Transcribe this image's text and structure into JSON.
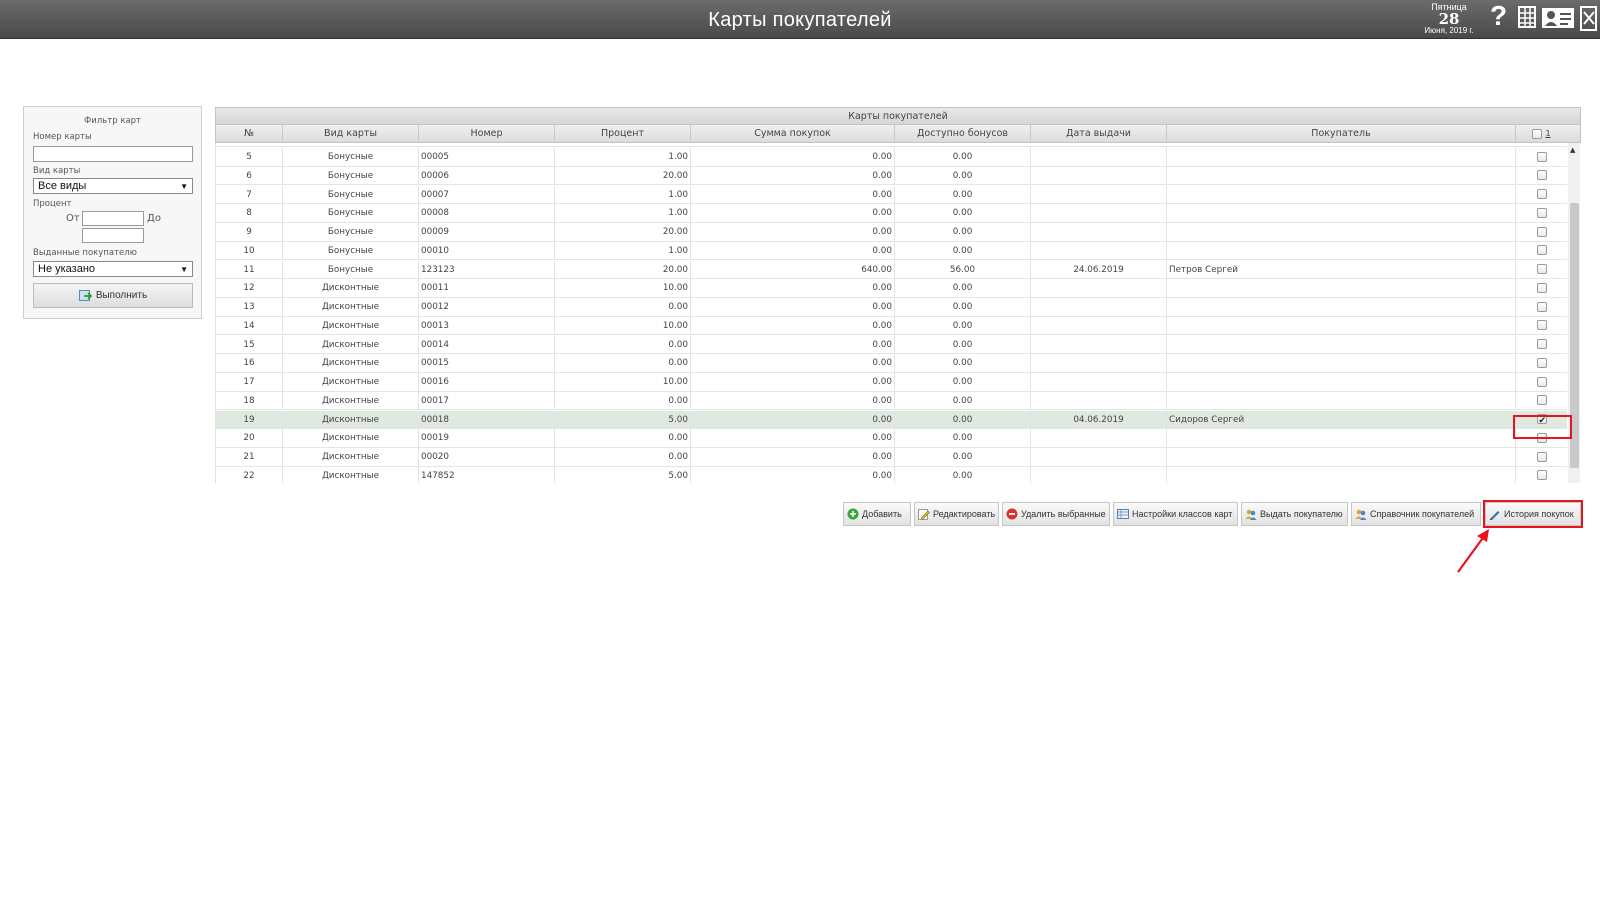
{
  "header": {
    "title": "Карты покупателей",
    "date": {
      "weekday": "Пятница",
      "day": "28",
      "month_year": "Июня, 2019 г."
    },
    "icons": [
      "help-icon",
      "grid-icon",
      "user-card-icon",
      "exit-icon"
    ]
  },
  "filter": {
    "title": "Фильтр карт",
    "card_number_label": "Номер карты",
    "card_number_value": "",
    "card_type_label": "Вид карты",
    "card_type_value": "Все виды",
    "percent_label": "Процент",
    "from_label": "От",
    "to_label": "До",
    "issued_label": "Выданные покупателю",
    "issued_value": "Не указано",
    "run_button": "Выполнить"
  },
  "grid": {
    "caption": "Карты покупателей",
    "columns": [
      "№",
      "Вид карты",
      "Номер",
      "Процент",
      "Сумма покупок",
      "Доступно бонусов",
      "Дата выдачи",
      "Покупатель"
    ],
    "select_all_count": "1",
    "rows": [
      {
        "n": "5",
        "type": "Бонусные",
        "number": "00005",
        "percent": "1.00",
        "sum": "0.00",
        "bonus": "0.00",
        "date": "",
        "buyer": "",
        "checked": false
      },
      {
        "n": "6",
        "type": "Бонусные",
        "number": "00006",
        "percent": "20.00",
        "sum": "0.00",
        "bonus": "0.00",
        "date": "",
        "buyer": "",
        "checked": false
      },
      {
        "n": "7",
        "type": "Бонусные",
        "number": "00007",
        "percent": "1.00",
        "sum": "0.00",
        "bonus": "0.00",
        "date": "",
        "buyer": "",
        "checked": false
      },
      {
        "n": "8",
        "type": "Бонусные",
        "number": "00008",
        "percent": "1.00",
        "sum": "0.00",
        "bonus": "0.00",
        "date": "",
        "buyer": "",
        "checked": false
      },
      {
        "n": "9",
        "type": "Бонусные",
        "number": "00009",
        "percent": "20.00",
        "sum": "0.00",
        "bonus": "0.00",
        "date": "",
        "buyer": "",
        "checked": false
      },
      {
        "n": "10",
        "type": "Бонусные",
        "number": "00010",
        "percent": "1.00",
        "sum": "0.00",
        "bonus": "0.00",
        "date": "",
        "buyer": "",
        "checked": false
      },
      {
        "n": "11",
        "type": "Бонусные",
        "number": "123123",
        "percent": "20.00",
        "sum": "640.00",
        "bonus": "56.00",
        "date": "24.06.2019",
        "buyer": "Петров Сергей",
        "checked": false
      },
      {
        "n": "12",
        "type": "Дисконтные",
        "number": "00011",
        "percent": "10.00",
        "sum": "0.00",
        "bonus": "0.00",
        "date": "",
        "buyer": "",
        "checked": false
      },
      {
        "n": "13",
        "type": "Дисконтные",
        "number": "00012",
        "percent": "0.00",
        "sum": "0.00",
        "bonus": "0.00",
        "date": "",
        "buyer": "",
        "checked": false
      },
      {
        "n": "14",
        "type": "Дисконтные",
        "number": "00013",
        "percent": "10.00",
        "sum": "0.00",
        "bonus": "0.00",
        "date": "",
        "buyer": "",
        "checked": false
      },
      {
        "n": "15",
        "type": "Дисконтные",
        "number": "00014",
        "percent": "0.00",
        "sum": "0.00",
        "bonus": "0.00",
        "date": "",
        "buyer": "",
        "checked": false
      },
      {
        "n": "16",
        "type": "Дисконтные",
        "number": "00015",
        "percent": "0.00",
        "sum": "0.00",
        "bonus": "0.00",
        "date": "",
        "buyer": "",
        "checked": false
      },
      {
        "n": "17",
        "type": "Дисконтные",
        "number": "00016",
        "percent": "10.00",
        "sum": "0.00",
        "bonus": "0.00",
        "date": "",
        "buyer": "",
        "checked": false
      },
      {
        "n": "18",
        "type": "Дисконтные",
        "number": "00017",
        "percent": "0.00",
        "sum": "0.00",
        "bonus": "0.00",
        "date": "",
        "buyer": "",
        "checked": false
      },
      {
        "n": "19",
        "type": "Дисконтные",
        "number": "00018",
        "percent": "5.00",
        "sum": "0.00",
        "bonus": "0.00",
        "date": "04.06.2019",
        "buyer": "Сидоров Сергей",
        "checked": true
      },
      {
        "n": "20",
        "type": "Дисконтные",
        "number": "00019",
        "percent": "0.00",
        "sum": "0.00",
        "bonus": "0.00",
        "date": "",
        "buyer": "",
        "checked": false
      },
      {
        "n": "21",
        "type": "Дисконтные",
        "number": "00020",
        "percent": "0.00",
        "sum": "0.00",
        "bonus": "0.00",
        "date": "",
        "buyer": "",
        "checked": false
      },
      {
        "n": "22",
        "type": "Дисконтные",
        "number": "147852",
        "percent": "5.00",
        "sum": "0.00",
        "bonus": "0.00",
        "date": "",
        "buyer": "",
        "checked": false
      }
    ]
  },
  "toolbar": {
    "add": "Добавить",
    "edit": "Редактировать",
    "delete_selected": "Удалить выбранные",
    "class_settings": "Настройки классов карт",
    "issue_to_buyer": "Выдать покупателю",
    "buyers_directory": "Справочник покупателей",
    "purchase_history": "История покупок"
  },
  "colors": {
    "header_bg": "#555555",
    "selected_row": "#dfe9df",
    "highlight": "#e8141c"
  }
}
